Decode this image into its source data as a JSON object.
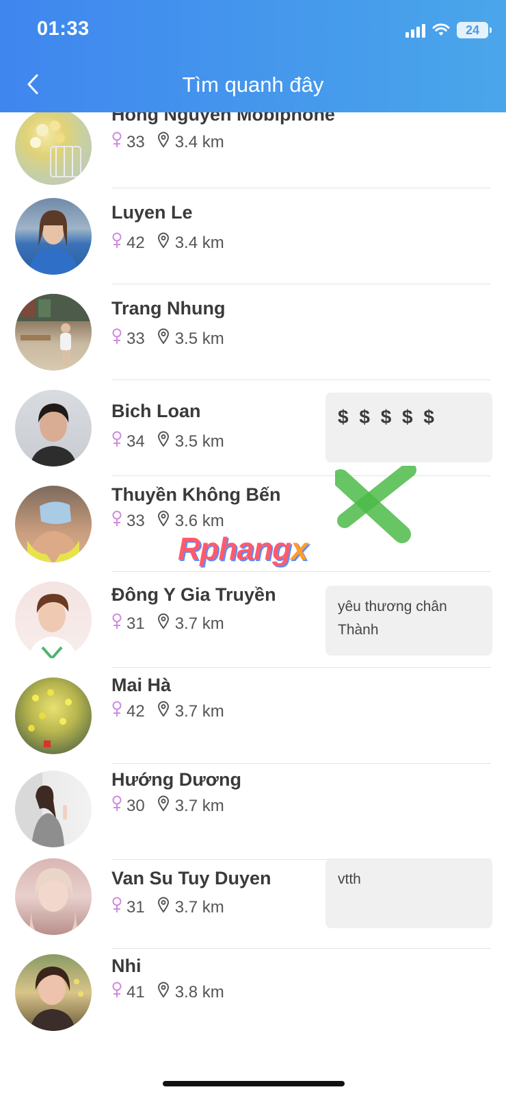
{
  "status": {
    "time": "01:33",
    "battery": "24"
  },
  "header": {
    "title": "Tìm quanh đây"
  },
  "people": [
    {
      "name": "Hong Nguyen Mobiphone",
      "age": "33",
      "distance": "3.4 km",
      "note": ""
    },
    {
      "name": "Luyen Le",
      "age": "42",
      "distance": "3.4 km",
      "note": ""
    },
    {
      "name": "Trang Nhung",
      "age": "33",
      "distance": "3.5 km",
      "note": ""
    },
    {
      "name": "Bich Loan",
      "age": "34",
      "distance": "3.5 km",
      "note": "$ $ $ $ $"
    },
    {
      "name": "Thuyền Không Bến",
      "age": "33",
      "distance": "3.6 km",
      "note": ""
    },
    {
      "name": "Đông Y Gia Truyền",
      "age": "31",
      "distance": "3.7 km",
      "note": "yêu thương chân Thành"
    },
    {
      "name": "Mai Hà",
      "age": "42",
      "distance": "3.7 km",
      "note": ""
    },
    {
      "name": "Hướng Dương",
      "age": "30",
      "distance": "3.7 km",
      "note": ""
    },
    {
      "name": "Van Su Tuy Duyen",
      "age": "31",
      "distance": "3.7 km",
      "note": "vtth"
    },
    {
      "name": "Nhi",
      "age": "41",
      "distance": "3.8 km",
      "note": ""
    }
  ],
  "watermark": {
    "main": "Rphang",
    "x": "x"
  },
  "colors": {
    "header_start": "#3f86ef",
    "header_end": "#4aa6ea",
    "gender_female": "#cf8be0"
  }
}
